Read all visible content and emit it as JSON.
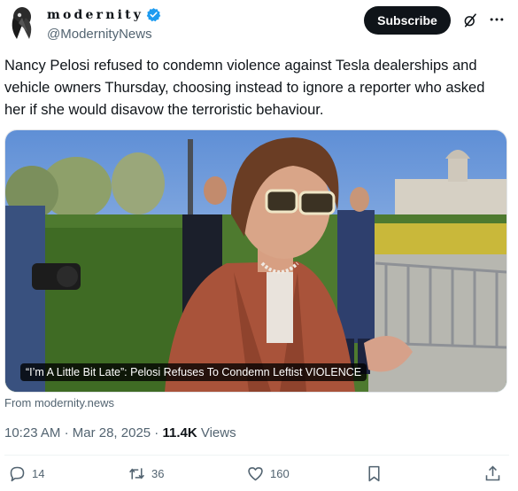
{
  "author": {
    "display_name": "modernity",
    "handle": "@ModernityNews",
    "avatar_icon": "plague-doctor-bird-logo",
    "verified_icon": "verified-badge-icon",
    "verified_color": "#1d9bf0"
  },
  "header": {
    "subscribe_label": "Subscribe",
    "grok_icon": "grok-icon",
    "more_icon": "more-icon"
  },
  "post": {
    "text": "Nancy Pelosi refused to condemn violence against Tesla dealerships and vehicle owners Thursday, choosing instead to ignore a reporter who asked her if she would disavow the terroristic behaviour."
  },
  "media": {
    "caption": "“I’m A Little Bit Late”: Pelosi Refuses To Condemn Leftist VIOLENCE",
    "source": "From modernity.news"
  },
  "meta": {
    "time": "10:23 AM",
    "separator": "·",
    "date": "Mar 28, 2025",
    "views_count": "11.4K",
    "views_label": "Views"
  },
  "actions": {
    "replies": "14",
    "reposts": "36",
    "likes": "160"
  },
  "colors": {
    "text_primary": "#0f1419",
    "text_secondary": "#536471",
    "accent": "#1d9bf0",
    "button_bg": "#0f1419"
  }
}
